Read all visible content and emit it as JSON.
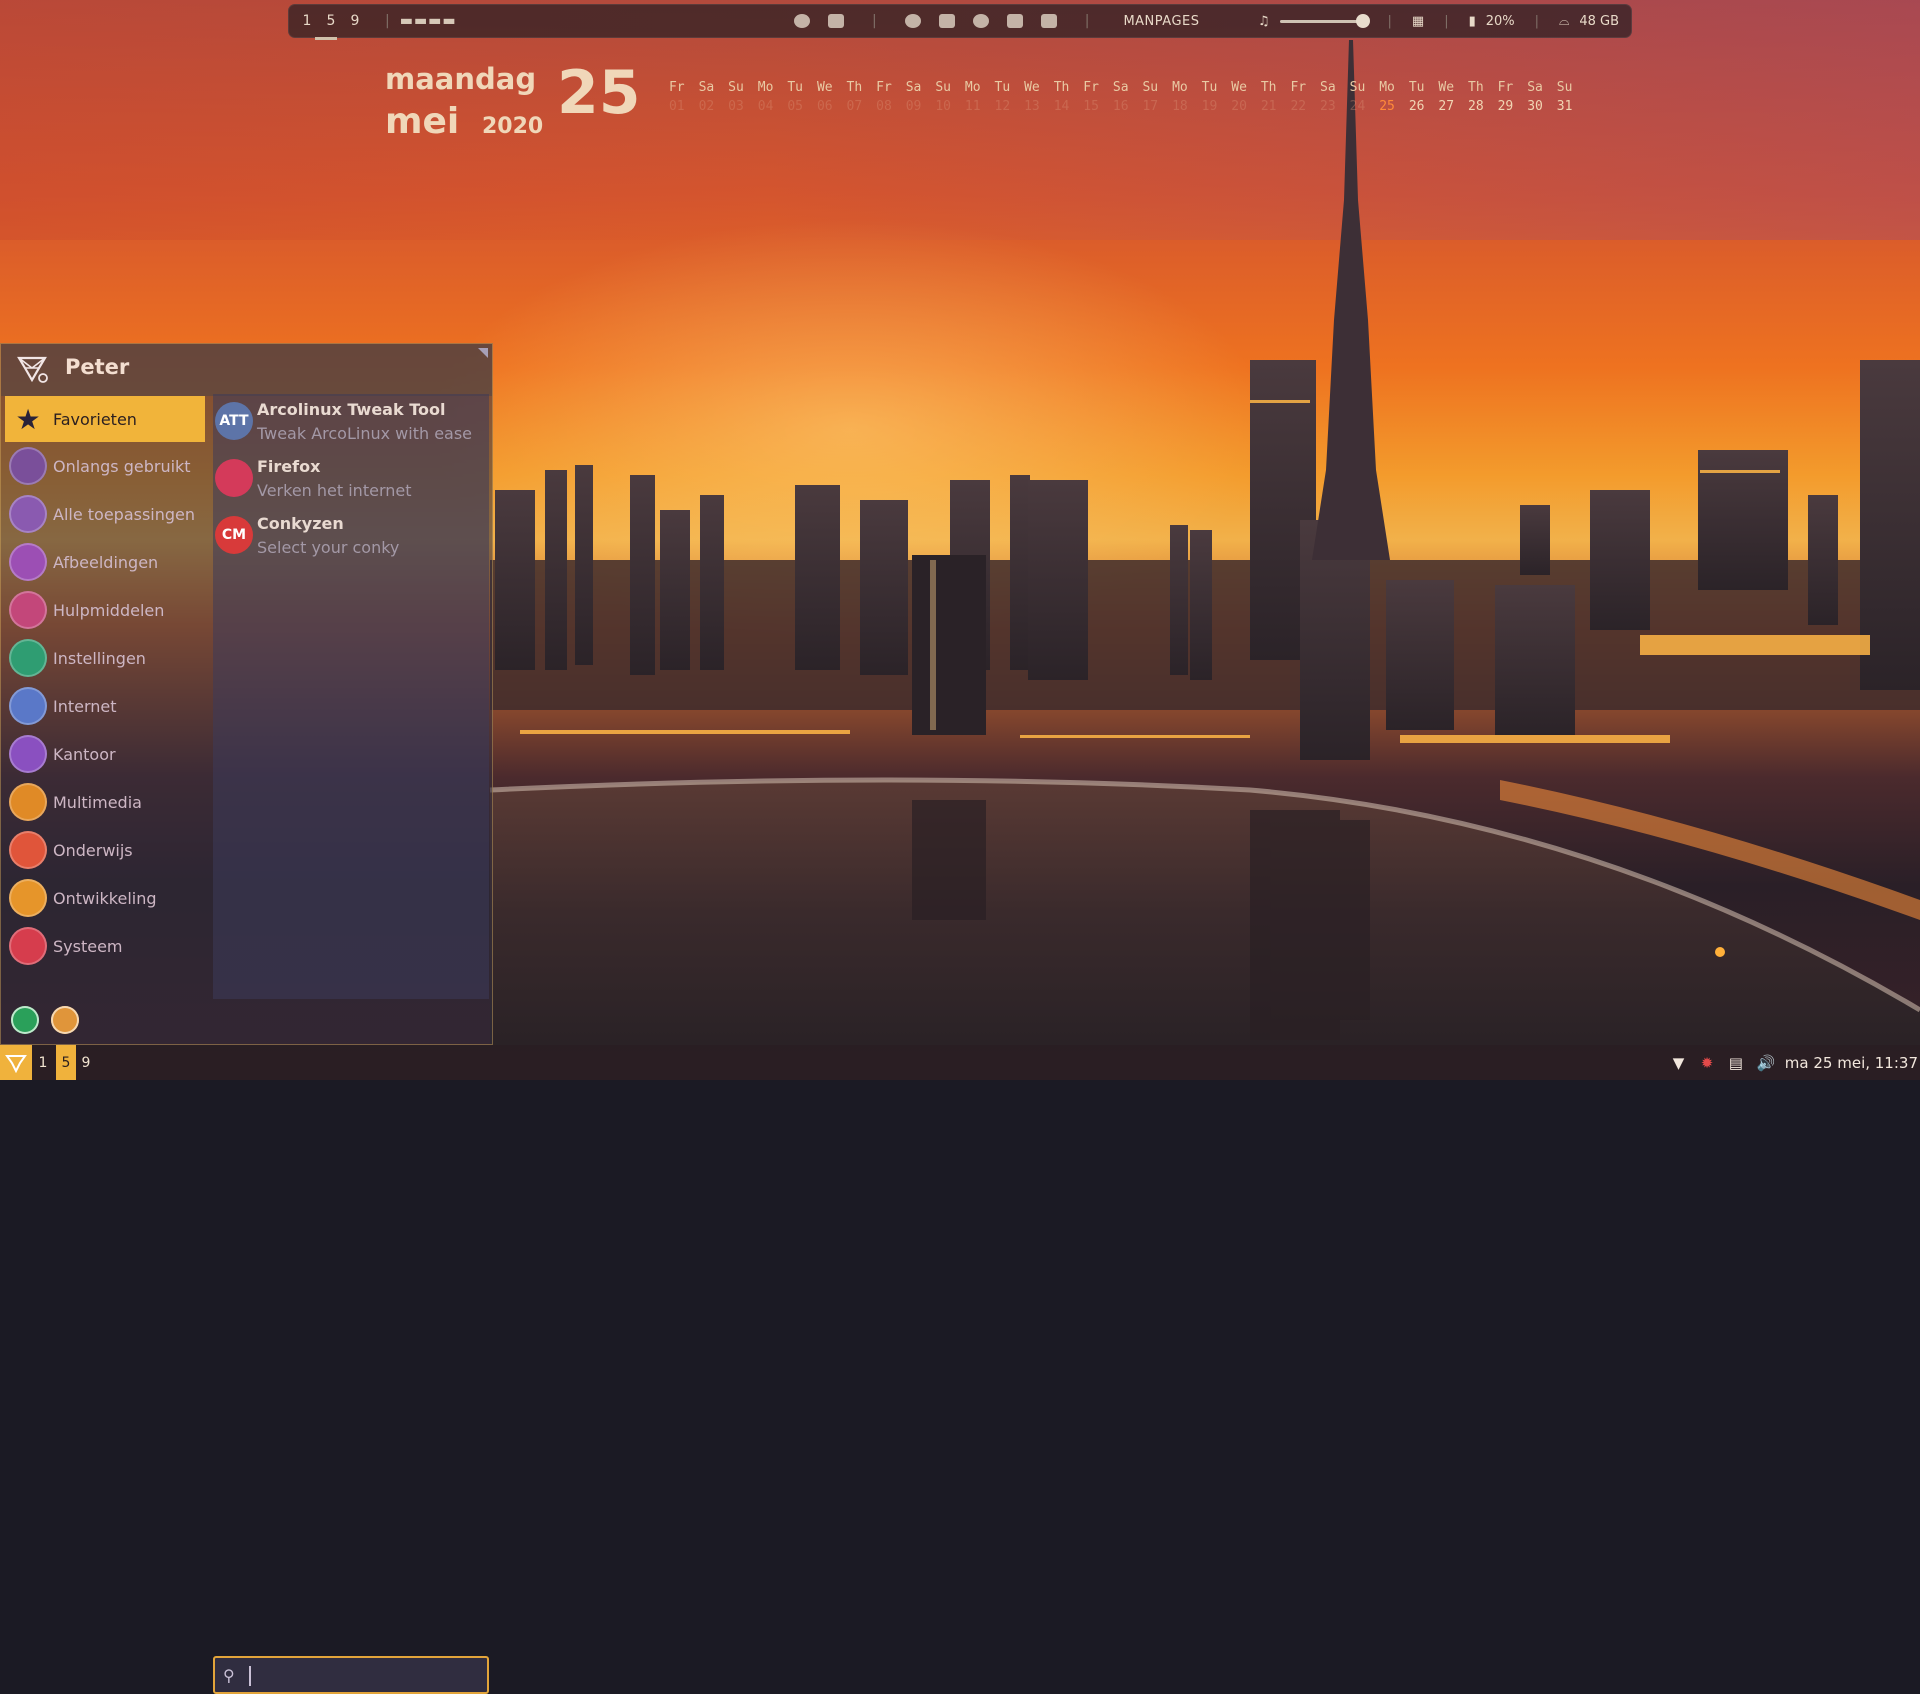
{
  "top_panel": {
    "workspaces": [
      "1",
      "5",
      "9"
    ],
    "separator": "|",
    "taskbar_dashes": "▬▬▬▬",
    "manpages_label": "MANPAGES",
    "battery": "20%",
    "disk": "48 GB"
  },
  "conky": {
    "day_name": "maandag",
    "month": "mei",
    "year": "2020",
    "day_number": "25",
    "calendar": {
      "weekdays": [
        "Fr",
        "Sa",
        "Su",
        "Mo",
        "Tu",
        "We",
        "Th",
        "Fr",
        "Sa",
        "Su",
        "Mo",
        "Tu",
        "We",
        "Th",
        "Fr",
        "Sa",
        "Su",
        "Mo",
        "Tu",
        "We",
        "Th",
        "Fr",
        "Sa",
        "Su",
        "Mo",
        "Tu",
        "We",
        "Th",
        "Fr",
        "Sa",
        "Su"
      ],
      "days": [
        "01",
        "02",
        "03",
        "04",
        "05",
        "06",
        "07",
        "08",
        "09",
        "10",
        "11",
        "12",
        "13",
        "14",
        "15",
        "16",
        "17",
        "18",
        "19",
        "20",
        "21",
        "22",
        "23",
        "24",
        "25",
        "26",
        "27",
        "28",
        "29",
        "30",
        "31"
      ],
      "today": "25"
    }
  },
  "menu": {
    "username": "Peter",
    "categories": [
      {
        "label": "Favorieten",
        "icon": "star-icon",
        "color": "#2a2338"
      },
      {
        "label": "Onlangs gebruikt",
        "icon": "clock-icon",
        "color": "#7a4f9a"
      },
      {
        "label": "Alle toepassingen",
        "icon": "apps-icon",
        "color": "#8a5ab0"
      },
      {
        "label": "Afbeeldingen",
        "icon": "graphics-icon",
        "color": "#9c4fb4"
      },
      {
        "label": "Hulpmiddelen",
        "icon": "accessories-icon",
        "color": "#c3477a"
      },
      {
        "label": "Instellingen",
        "icon": "settings-icon",
        "color": "#2f9d72"
      },
      {
        "label": "Internet",
        "icon": "internet-icon",
        "color": "#5a78c8"
      },
      {
        "label": "Kantoor",
        "icon": "office-icon",
        "color": "#8a50c0"
      },
      {
        "label": "Multimedia",
        "icon": "multimedia-icon",
        "color": "#e08a26"
      },
      {
        "label": "Onderwijs",
        "icon": "education-icon",
        "color": "#e0553a"
      },
      {
        "label": "Ontwikkeling",
        "icon": "development-icon",
        "color": "#e6952a"
      },
      {
        "label": "Systeem",
        "icon": "system-icon",
        "color": "#d63d4d"
      }
    ],
    "apps": [
      {
        "name": "Arcolinux Tweak Tool",
        "desc": "Tweak ArcoLinux with ease",
        "icon": "arcolinux-tweak-tool-icon",
        "icon_text": "ATT",
        "color": "#5d74a8"
      },
      {
        "name": "Firefox",
        "desc": "Verken het internet",
        "icon": "firefox-icon",
        "icon_text": "",
        "color": "#d43a5a"
      },
      {
        "name": "Conkyzen",
        "desc": "Select your conky",
        "icon": "conkyzen-icon",
        "icon_text": "CM",
        "color": "#d83a3a"
      }
    ],
    "search_placeholder": ""
  },
  "bottom_panel": {
    "workspaces": [
      "1",
      "5",
      "9"
    ],
    "clock": "ma 25 mei, 11:37"
  }
}
